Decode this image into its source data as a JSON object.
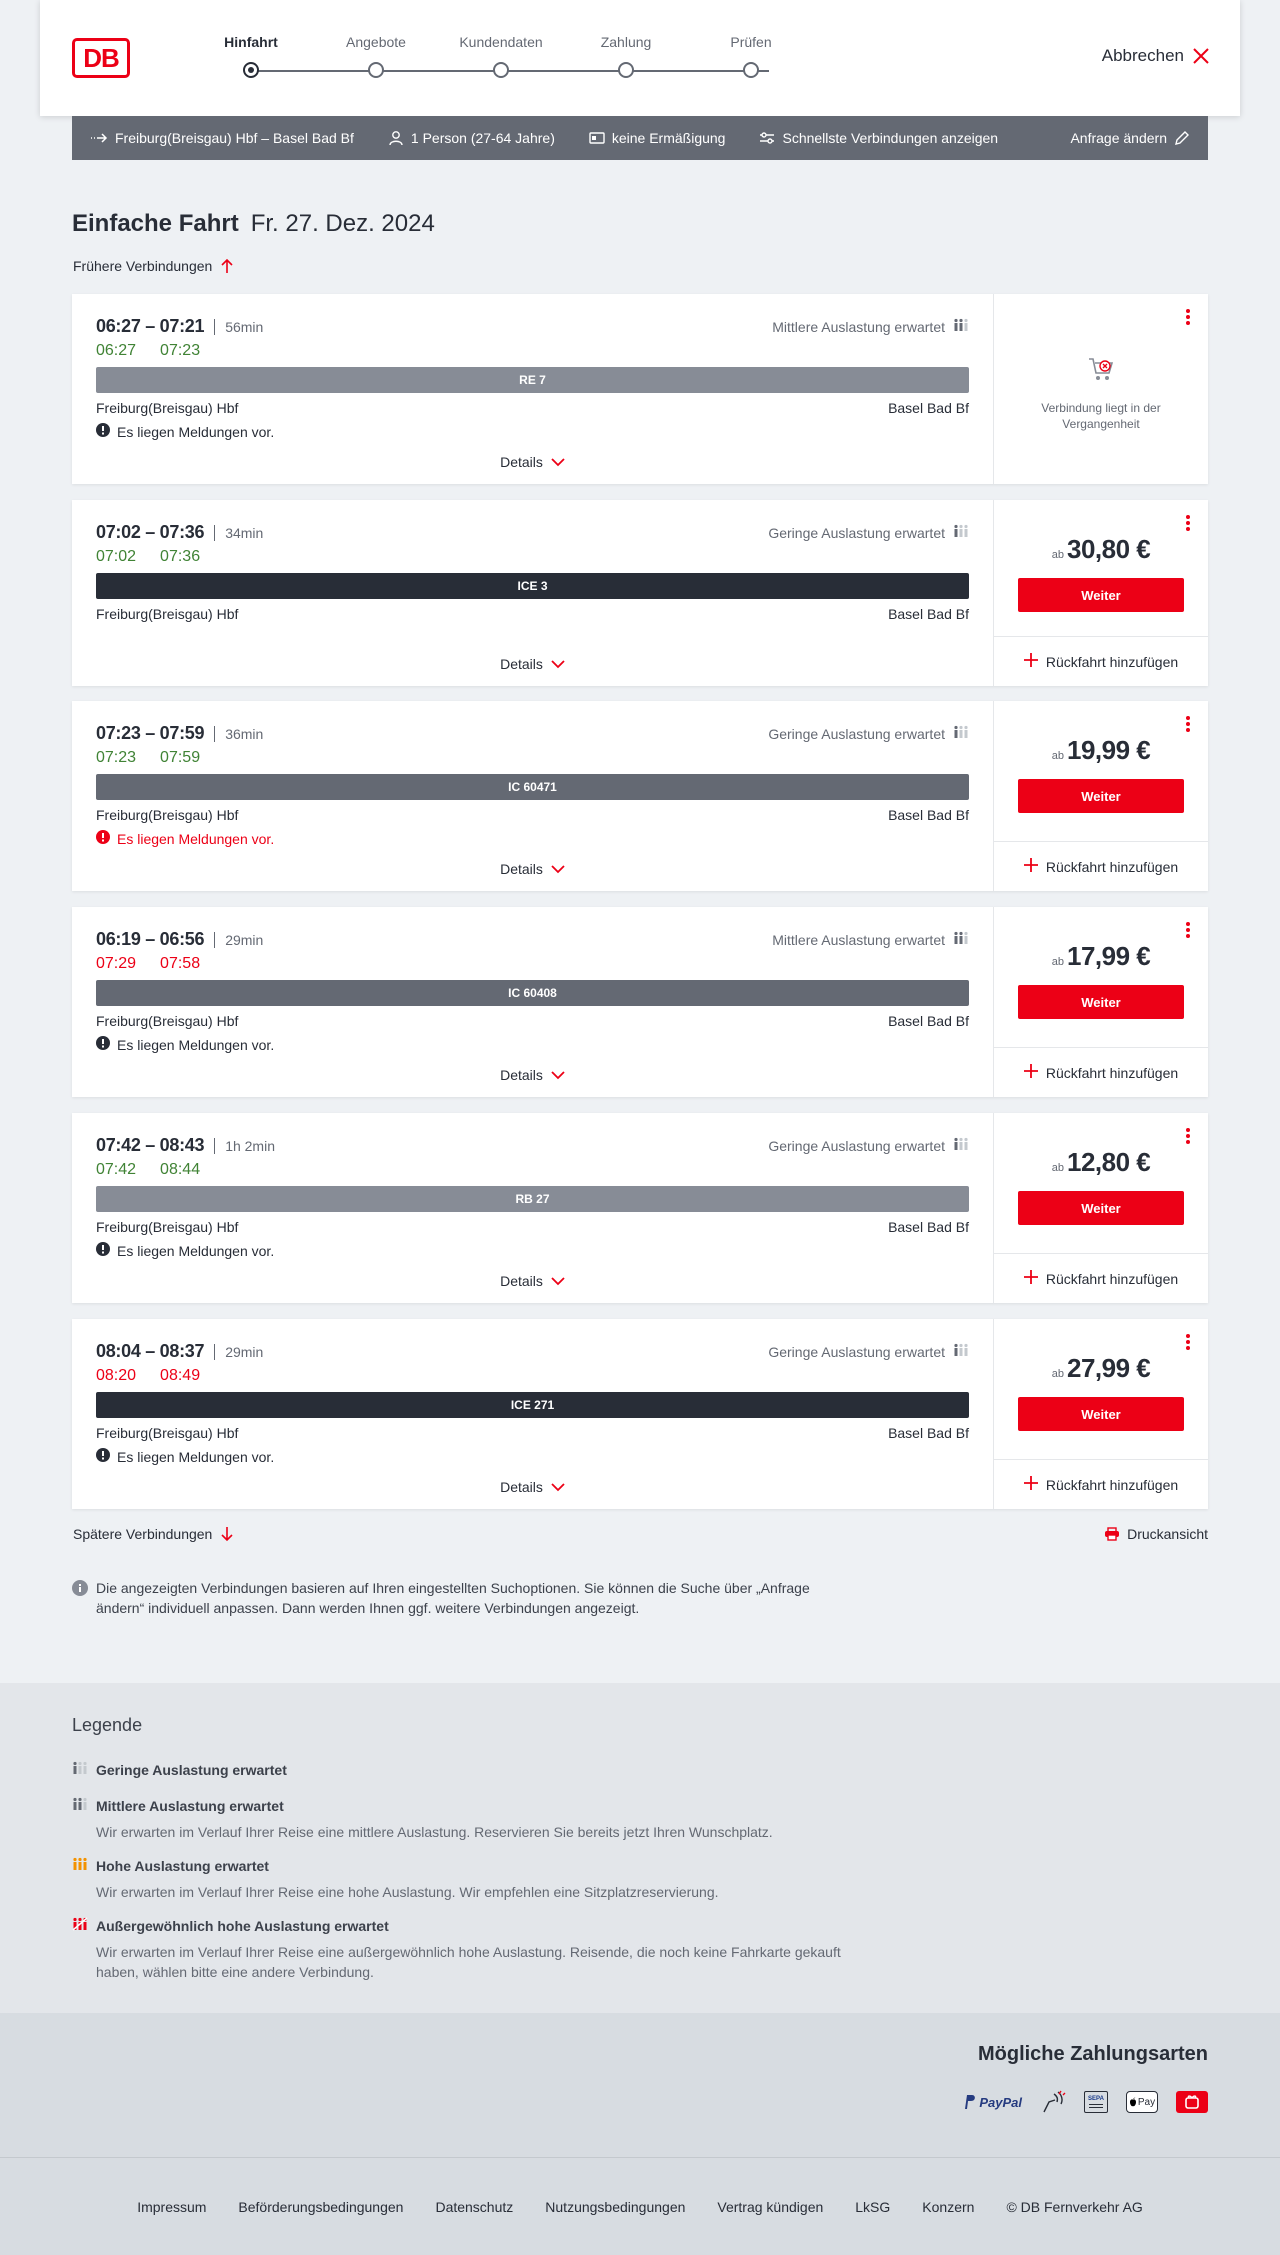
{
  "header": {
    "logo_text": "DB",
    "steps": [
      {
        "label": "Hinfahrt",
        "active": true
      },
      {
        "label": "Angebote",
        "active": false
      },
      {
        "label": "Kundendaten",
        "active": false
      },
      {
        "label": "Zahlung",
        "active": false
      },
      {
        "label": "Prüfen",
        "active": false
      }
    ],
    "cancel_label": "Abbrechen"
  },
  "searchbar": {
    "route": "Freiburg(Breisgau) Hbf – Basel Bad Bf",
    "persons": "1 Person (27-64 Jahre)",
    "discount": "keine Ermäßigung",
    "fastest": "Schnellste Verbindungen anzeigen",
    "change": "Anfrage ändern"
  },
  "title": {
    "main": "Einfache Fahrt",
    "date": "Fr. 27. Dez. 2024"
  },
  "earlier_label": "Frühere Verbindungen",
  "later_label": "Spätere Verbindungen",
  "print_label": "Druckansicht",
  "details_label": "Details",
  "weiter_label": "Weiter",
  "return_label": "Rückfahrt hinzufügen",
  "ab_label": "ab",
  "past_label": "Verbindung liegt in der Vergangenheit",
  "connections": [
    {
      "planned": "06:27 – 07:21",
      "duration": "56min",
      "rt_dep": "06:27",
      "rt_arr": "07:23",
      "rt_dep_late": false,
      "rt_arr_late": false,
      "auslastung": "Mittlere Auslastung erwartet",
      "train": "RE 7",
      "train_color": "#878c96",
      "from": "Freiburg(Breisgau) Hbf",
      "to": "Basel Bad Bf",
      "meldung": "Es liegen Meldungen vor.",
      "meldung_red": false,
      "price": null,
      "past": true
    },
    {
      "planned": "07:02 – 07:36",
      "duration": "34min",
      "rt_dep": "07:02",
      "rt_arr": "07:36",
      "rt_dep_late": false,
      "rt_arr_late": false,
      "auslastung": "Geringe Auslastung erwartet",
      "train": "ICE 3",
      "train_color": "#282d37",
      "from": "Freiburg(Breisgau) Hbf",
      "to": "Basel Bad Bf",
      "meldung": null,
      "meldung_red": false,
      "price": "30,80 €",
      "past": false
    },
    {
      "planned": "07:23 – 07:59",
      "duration": "36min",
      "rt_dep": "07:23",
      "rt_arr": "07:59",
      "rt_dep_late": false,
      "rt_arr_late": false,
      "auslastung": "Geringe Auslastung erwartet",
      "train": "IC 60471",
      "train_color": "#646973",
      "from": "Freiburg(Breisgau) Hbf",
      "to": "Basel Bad Bf",
      "meldung": "Es liegen Meldungen vor.",
      "meldung_red": true,
      "price": "19,99 €",
      "past": false
    },
    {
      "planned": "06:19 – 06:56",
      "duration": "29min",
      "rt_dep": "07:29",
      "rt_arr": "07:58",
      "rt_dep_late": true,
      "rt_arr_late": true,
      "auslastung": "Mittlere Auslastung erwartet",
      "train": "IC 60408",
      "train_color": "#646973",
      "from": "Freiburg(Breisgau) Hbf",
      "to": "Basel Bad Bf",
      "meldung": "Es liegen Meldungen vor.",
      "meldung_red": false,
      "price": "17,99 €",
      "past": false
    },
    {
      "planned": "07:42 – 08:43",
      "duration": "1h 2min",
      "rt_dep": "07:42",
      "rt_arr": "08:44",
      "rt_dep_late": false,
      "rt_arr_late": false,
      "auslastung": "Geringe Auslastung erwartet",
      "train": "RB 27",
      "train_color": "#878c96",
      "from": "Freiburg(Breisgau) Hbf",
      "to": "Basel Bad Bf",
      "meldung": "Es liegen Meldungen vor.",
      "meldung_red": false,
      "price": "12,80 €",
      "past": false
    },
    {
      "planned": "08:04 – 08:37",
      "duration": "29min",
      "rt_dep": "08:20",
      "rt_arr": "08:49",
      "rt_dep_late": true,
      "rt_arr_late": true,
      "auslastung": "Geringe Auslastung erwartet",
      "train": "ICE 271",
      "train_color": "#282d37",
      "from": "Freiburg(Breisgau) Hbf",
      "to": "Basel Bad Bf",
      "meldung": "Es liegen Meldungen vor.",
      "meldung_red": false,
      "price": "27,99 €",
      "past": false
    }
  ],
  "info_text": "Die angezeigten Verbindungen basieren auf Ihren eingestellten Suchoptionen. Sie können die Suche über „Anfrage ändern“ individuell anpassen. Dann werden Ihnen ggf. weitere Verbindungen angezeigt.",
  "legend": {
    "title": "Legende",
    "items": [
      {
        "head": "Geringe Auslastung erwartet",
        "desc": "",
        "level": 1,
        "color": "#646973"
      },
      {
        "head": "Mittlere Auslastung erwartet",
        "desc": "Wir erwarten im Verlauf Ihrer Reise eine mittlere Auslastung. Reservieren Sie bereits jetzt Ihren Wunschplatz.",
        "level": 2,
        "color": "#646973"
      },
      {
        "head": "Hohe Auslastung erwartet",
        "desc": "Wir erwarten im Verlauf Ihrer Reise eine hohe Auslastung. Wir empfehlen eine Sitzplatzreservierung.",
        "level": 3,
        "color": "#f39200"
      },
      {
        "head": "Außergewöhnlich hohe Auslastung erwartet",
        "desc": "Wir erwarten im Verlauf Ihrer Reise eine außergewöhnlich hohe Auslastung. Reisende, die noch keine Fahrkarte gekauft haben, wählen bitte eine andere Verbindung.",
        "level": 4,
        "color": "#ec0016"
      }
    ]
  },
  "payment": {
    "title": "Mögliche Zahlungsarten",
    "paypal": "PayPal",
    "sepa": "SEPA",
    "applepay": "Pay"
  },
  "footer": {
    "links": [
      "Impressum",
      "Beförderungsbedingungen",
      "Datenschutz",
      "Nutzungsbedingungen",
      "Vertrag kündigen",
      "LkSG",
      "Konzern"
    ],
    "copyright": "© DB Fernverkehr AG"
  },
  "colors": {
    "brand_red": "#ec0016",
    "green": "#408335",
    "dark": "#282d37",
    "grey": "#646973"
  }
}
